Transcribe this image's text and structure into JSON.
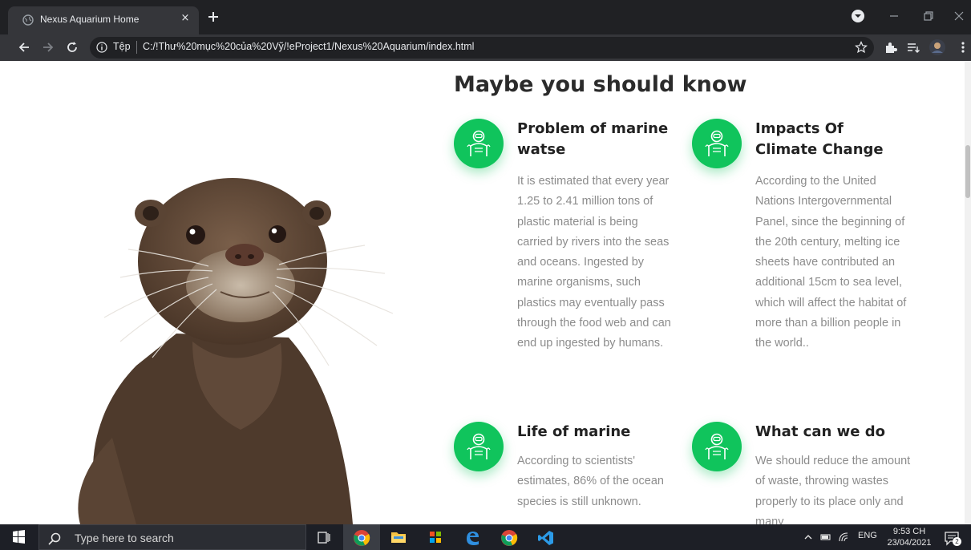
{
  "browser": {
    "tab_title": "Nexus Aquarium Home",
    "tab_close": "×",
    "address_scheme": "Tệp",
    "address_url": "C:/!Thư%20mục%20của%20Vỹ/!eProject1/Nexus%20Aquarium/index.html"
  },
  "page": {
    "section_title": "Maybe you should know",
    "cards": [
      {
        "title": "Problem of marine watse",
        "body": "It is estimated that every year 1.25 to 2.41 million tons of plastic material is being carried by rivers into the seas and oceans. Ingested by marine organisms, such plastics may eventually pass through the food web and can end up ingested by humans."
      },
      {
        "title": "Impacts Of Climate Change",
        "body": "According to the United Nations Intergovernmental Panel, since the beginning of the 20th century, melting ice sheets have contributed an additional 15cm to sea level, which will affect the habitat of more than a billion people in the world.."
      },
      {
        "title": "Life of marine",
        "body": "According to scientists' estimates, 86% of the ocean species is still unknown."
      },
      {
        "title": "What can we do",
        "body": "We should reduce the amount of waste, throwing wastes properly to its place only and many"
      }
    ],
    "accent_color": "#10c45c"
  },
  "taskbar": {
    "search_placeholder": "Type here to search",
    "language": "ENG",
    "time": "9:53 CH",
    "date": "23/04/2021",
    "notification_count": "2"
  }
}
